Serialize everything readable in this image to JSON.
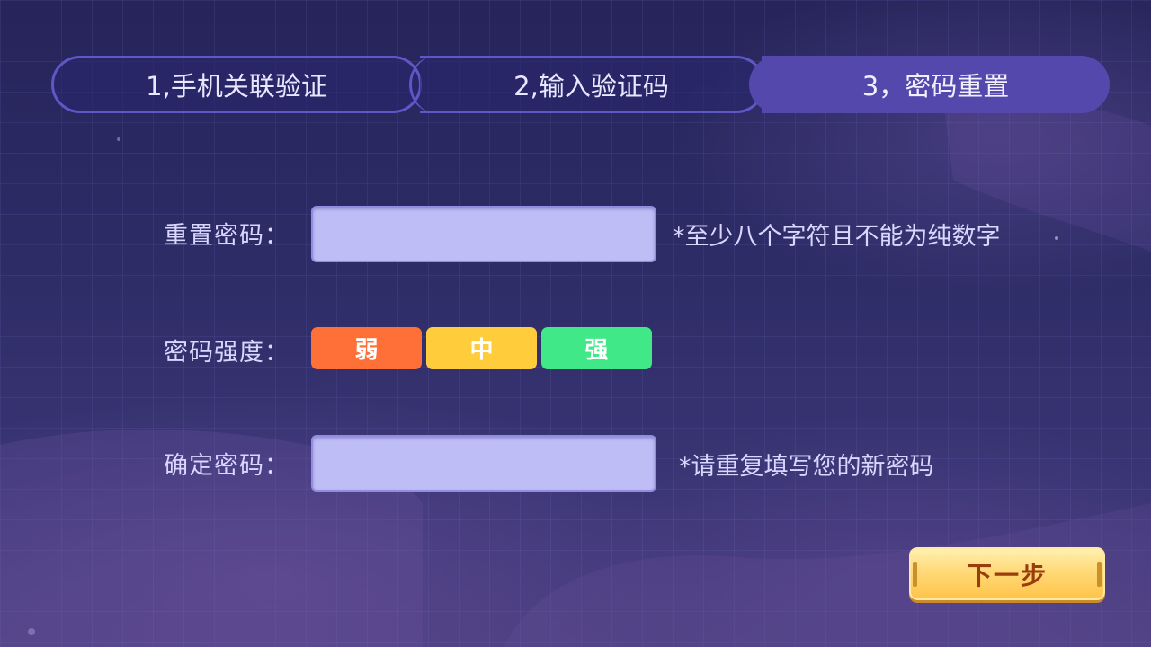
{
  "steps": [
    {
      "label": "1,手机关联验证"
    },
    {
      "label": "2,输入验证码"
    },
    {
      "label": "3，密码重置"
    }
  ],
  "form": {
    "reset_password": {
      "label": "重置密码：",
      "value": "",
      "hint": "*至少八个字符且不能为纯数字"
    },
    "strength": {
      "label": "密码强度：",
      "levels": [
        "弱",
        "中",
        "强"
      ]
    },
    "confirm_password": {
      "label": "确定密码：",
      "value": "",
      "hint": "*请重复填写您的新密码"
    }
  },
  "actions": {
    "next_label": "下一步"
  },
  "colors": {
    "weak": "#ff7038",
    "medium": "#ffcc3c",
    "strong": "#41e887",
    "active_step": "#5548ad"
  }
}
